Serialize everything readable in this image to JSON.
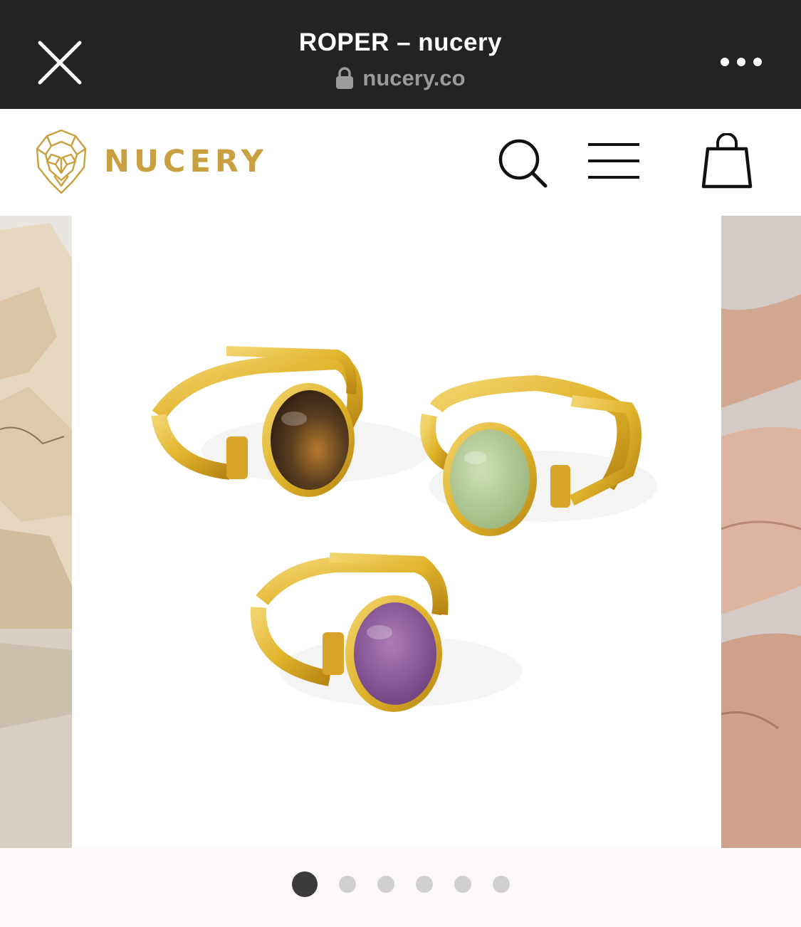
{
  "browser": {
    "title": "ROPER – nucery",
    "url": "nucery.co",
    "close_icon": "close-icon",
    "lock_icon": "lock-icon",
    "more_icon": "more-dots-icon"
  },
  "header": {
    "logo_text": "NUCERY",
    "icons": [
      "search-icon",
      "menu-icon",
      "shopping-bag-icon"
    ]
  },
  "gallery": {
    "current_image": 1,
    "total_images": 6,
    "stones": [
      {
        "name": "tiger eye",
        "color": "#5a3d1f"
      },
      {
        "name": "jade",
        "color": "#b5cd96"
      },
      {
        "name": "amethyst",
        "color": "#8a5596"
      }
    ]
  },
  "colors": {
    "brand_gold": "#c9a03f",
    "browser_bar": "#232323",
    "pager_active": "#3b3b3b",
    "pager_inactive": "#d0d0d0"
  }
}
